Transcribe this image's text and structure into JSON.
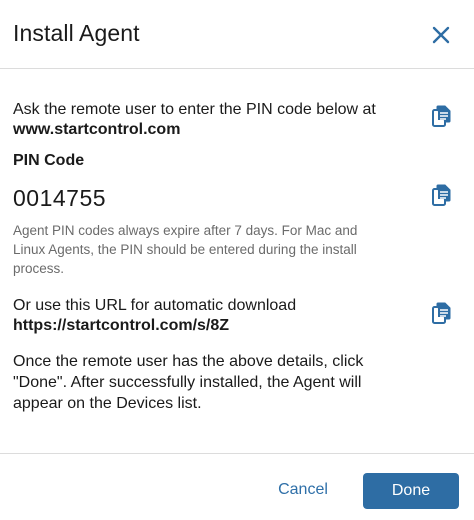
{
  "dialog": {
    "title": "Install Agent",
    "close_icon": "close-icon"
  },
  "instructions": {
    "line1": "Ask the remote user to enter the PIN code below at",
    "url": "www.startcontrol.com",
    "copy_icon": "copy-icon"
  },
  "pin": {
    "label": "PIN Code",
    "value": "0014755",
    "copy_icon": "copy-icon",
    "note_line1": "Agent PIN codes always expire after 7 days. For Mac and",
    "note_line2": "Linux Agents, the PIN should be entered during the install",
    "note_line3": "process."
  },
  "download": {
    "line1": "Or use this URL for automatic download",
    "url": "https://startcontrol.com/s/8Z",
    "copy_icon": "copy-icon"
  },
  "closing": {
    "line1": "Once the remote user has the above details, click",
    "line2": "\"Done\". After successfully installed, the Agent will",
    "line3": "appear on the Devices list."
  },
  "footer": {
    "cancel_label": "Cancel",
    "done_label": "Done"
  },
  "colors": {
    "accent": "#2e6da4",
    "link_text": "#2e6fa8",
    "muted_text": "#6b6b6b",
    "divider": "#dcdcdc"
  }
}
